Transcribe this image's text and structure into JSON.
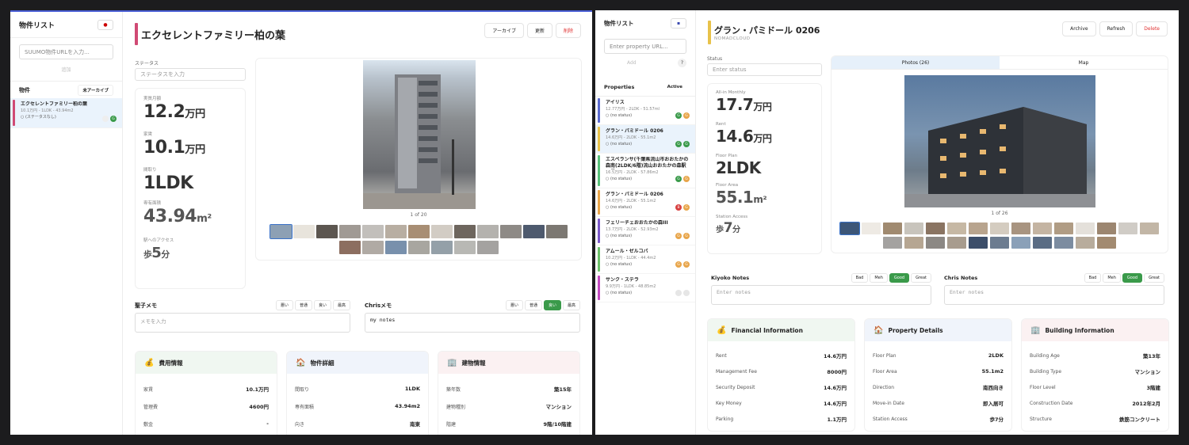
{
  "left": {
    "sidebar": {
      "title": "物件リスト",
      "url_placeholder": "SUUMO物件URLを入力...",
      "add_label": "追加",
      "section_label": "物件",
      "filter_label": "未アーカイブ",
      "items": [
        {
          "name": "エクセレントファミリー柏の葉",
          "meta": "10.1万円 - 1LDK - 43.94m2",
          "status": "(ステータスなし)",
          "color": "#d04a74"
        }
      ]
    },
    "title": "エクセレントファミリー柏の葉",
    "buttons": {
      "archive": "アーカイブ",
      "refresh": "更新",
      "delete": "削除"
    },
    "status_label": "ステータス",
    "status_placeholder": "ステータスを入力",
    "stats": [
      {
        "label": "実質月額",
        "value": "12.2",
        "unit": "万円"
      },
      {
        "label": "家賃",
        "value": "10.1",
        "unit": "万円"
      },
      {
        "label": "間取り",
        "value": "1LDK",
        "unit": ""
      },
      {
        "label": "専有面積",
        "value": "43.94",
        "unit": "m²"
      },
      {
        "label": "駅へのアクセス",
        "prefix": "歩",
        "value": "5",
        "unit": "分"
      }
    ],
    "photo_count": "1 of 20",
    "notes": [
      {
        "title": "聖子メモ",
        "rates": [
          "悪い",
          "普通",
          "良い",
          "最高"
        ],
        "active": -1,
        "placeholder": "メモを入力",
        "value": ""
      },
      {
        "title": "Chrisメモ",
        "rates": [
          "悪い",
          "普通",
          "良い",
          "最高"
        ],
        "active": 2,
        "placeholder": "",
        "value": "my notes"
      }
    ],
    "cards": [
      {
        "icon": "💰",
        "title": "費用情報",
        "rows": [
          [
            "家賃",
            "10.1万円"
          ],
          [
            "管理費",
            "4600円"
          ],
          [
            "敷金",
            "-"
          ]
        ]
      },
      {
        "icon": "🏠",
        "title": "物件詳細",
        "rows": [
          [
            "間取り",
            "1LDK"
          ],
          [
            "専有面積",
            "43.94m2"
          ],
          [
            "向き",
            "南東"
          ]
        ]
      },
      {
        "icon": "🏢",
        "title": "建物情報",
        "rows": [
          [
            "築年数",
            "築15年"
          ],
          [
            "建物種別",
            "マンション"
          ],
          [
            "階建",
            "9階/10階建"
          ]
        ]
      }
    ]
  },
  "right": {
    "sidebar": {
      "title": "物件リスト",
      "url_placeholder": "Enter property URL...",
      "add_label": "Add",
      "help_label": "?",
      "section_label": "Properties",
      "filter_label": "Active",
      "items": [
        {
          "name": "アイリス",
          "meta": "12.77万円 - 2LDK - 51.57ml",
          "status": "(no status)",
          "color": "#5b6bd0"
        },
        {
          "name": "グラン・パミドール 0206",
          "meta": "14.6万円 - 2LDK - 55.1m2",
          "status": "(no status)",
          "color": "#e8c24a"
        },
        {
          "name": "エスペランサ(千葉県流山市おおたかの森南(2LDK/6階)流山おおたかの森駅の賃…",
          "meta": "16.5万円 - 2LDK - 57.86m2",
          "status": "(no status)",
          "color": "#58c07a"
        },
        {
          "name": "グラン・パミドール 0206",
          "meta": "14.6万円 - 2LDK - 55.1m2",
          "status": "(no status)",
          "color": "#e8a54a"
        },
        {
          "name": "フェリーチェおおたかの森III",
          "meta": "13.7万円 - 2LDK - 52.93m2",
          "status": "(no status)",
          "color": "#7a58c8"
        },
        {
          "name": "アムール・ゼルコバ",
          "meta": "10.2万円 - 1LDK - 44.4m2",
          "status": "(no status)",
          "color": "#6cc06a"
        },
        {
          "name": "サンク・ステラ",
          "meta": "9.9万円 - 1LDK - 48.85m2",
          "status": "(no status)",
          "color": "#c24ac0"
        }
      ]
    },
    "title": "グラン・パミドール 0206",
    "subtitle": "NOMADCLOUD",
    "buttons": {
      "archive": "Archive",
      "refresh": "Refresh",
      "delete": "Delete"
    },
    "status_label": "Status",
    "status_placeholder": "Enter status",
    "stats": [
      {
        "label": "All-in Monthly",
        "value": "17.7",
        "unit": "万円"
      },
      {
        "label": "Rent",
        "value": "14.6",
        "unit": "万円"
      },
      {
        "label": "Floor Plan",
        "value": "2LDK",
        "unit": ""
      },
      {
        "label": "Floor Area",
        "value": "55.1",
        "unit": "m²"
      },
      {
        "label": "Station Access",
        "prefix": "歩",
        "value": "7",
        "unit": "分"
      }
    ],
    "tabs": [
      "Photos (26)",
      "Map"
    ],
    "photo_count": "1 of 26",
    "notes": [
      {
        "title": "Kiyoko Notes",
        "rates": [
          "Bad",
          "Meh",
          "Good",
          "Great"
        ],
        "active": 2,
        "placeholder": "Enter notes",
        "value": ""
      },
      {
        "title": "Chris Notes",
        "rates": [
          "Bad",
          "Meh",
          "Good",
          "Great"
        ],
        "active": 2,
        "placeholder": "Enter notes",
        "value": ""
      }
    ],
    "cards": [
      {
        "icon": "💰",
        "title": "Financial Information",
        "rows": [
          [
            "Rent",
            "14.6万円"
          ],
          [
            "Management Fee",
            "8000円"
          ],
          [
            "Security Deposit",
            "14.6万円"
          ],
          [
            "Key Money",
            "14.6万円"
          ],
          [
            "Parking",
            "1.1万円"
          ]
        ]
      },
      {
        "icon": "🏠",
        "title": "Property Details",
        "rows": [
          [
            "Floor Plan",
            "2LDK"
          ],
          [
            "Floor Area",
            "55.1m2"
          ],
          [
            "Direction",
            "南西向き"
          ],
          [
            "Move-in Date",
            "即入居可"
          ],
          [
            "Station Access",
            "歩7分"
          ]
        ]
      },
      {
        "icon": "🏢",
        "title": "Building Information",
        "rows": [
          [
            "Building Age",
            "築13年"
          ],
          [
            "Building Type",
            "マンション"
          ],
          [
            "Floor Level",
            "3階建"
          ],
          [
            "Construction Date",
            "2012年2月"
          ],
          [
            "Structure",
            "鉄筋コンクリート"
          ]
        ]
      }
    ]
  }
}
